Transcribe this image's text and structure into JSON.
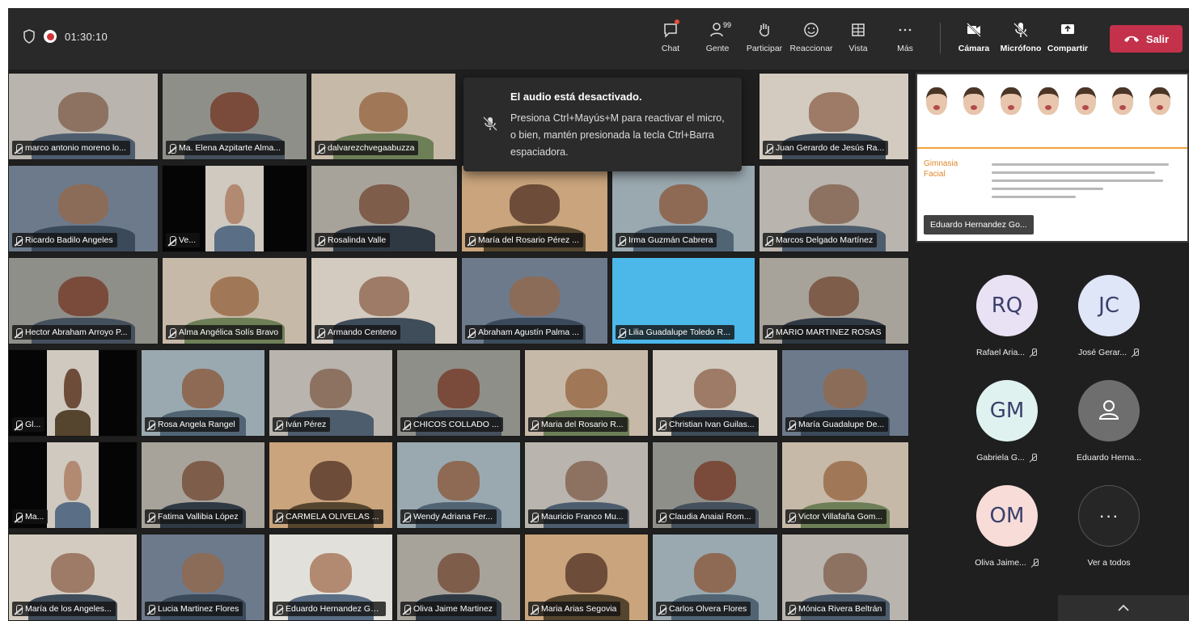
{
  "meeting": {
    "timer": "01:30:10"
  },
  "toolbar": {
    "chat": "Chat",
    "people": "Gente",
    "people_count": "99",
    "raise_hand": "Participar",
    "react": "Reaccionar",
    "view": "Vista",
    "more": "Más",
    "camera": "Cámara",
    "mic": "Micrófono",
    "share": "Compartir",
    "leave": "Salir"
  },
  "notification": {
    "title": "El audio está desactivado.",
    "body": "Presiona Ctrl+Mayús+M para reactivar el micro, o bien, mantén presionada la tecla Ctrl+Barra espaciadora."
  },
  "participants": [
    "marco antonio moreno lo...",
    "Ma. Elena Azpitarte Alma...",
    "dalvarezchvegaabuzza",
    "Juan Gerardo de Jesús Ra...",
    "Ricardo Badilo Angeles",
    "Ve...",
    "Rosalinda Valle",
    "María del Rosario Pérez ...",
    "Irma Guzmán Cabrera",
    "Marcos Delgado Martínez",
    "Hector Abraham Arroyo P...",
    "Alma Angélica Solís Bravo",
    "Armando Centeno",
    "Abraham Agustín Palma ...",
    "Lilia Guadalupe Toledo R...",
    "MARIO MARTINEZ ROSAS",
    "Gl...",
    "Rosa Angela Rangel",
    "Iván Pérez",
    "CHICOS COLLADO ...",
    "Maria del Rosario R...",
    "Christian Ivan Guilas...",
    "María Guadalupe De...",
    "Ma...",
    "Fatima Vallibia López",
    "CARMELA OLIVELAS ...",
    "Wendy Adriana Fer...",
    "Mauricio Franco Mu...",
    "Claudia Anaiaí Rom...",
    "Victor Villafaña Gom...",
    "María de los Angeles...",
    "Lucia Martinez Flores",
    "Eduardo Hernandez Go...",
    "Oliva Jaime Martinez",
    "Maria Arias Segovia",
    "Carlos Olvera Flores",
    "Mónica Rivera Beltrán"
  ],
  "shared_content": {
    "presenter": "Eduardo Hernandez Go...",
    "slide_title": "Gimnasia Facial"
  },
  "roster": [
    {
      "initials": "RQ",
      "name": "Rafael Aria...",
      "color": "#e9e2f4"
    },
    {
      "initials": "JC",
      "name": "José Gerar...",
      "color": "#dfe6f7"
    },
    {
      "initials": "GM",
      "name": "Gabriela G...",
      "color": "#dff2ef"
    },
    {
      "initials": "",
      "name": "Eduardo Herna...",
      "color": "#6e6e6e"
    },
    {
      "initials": "OM",
      "name": "Oliva Jaime...",
      "color": "#f7dcd8"
    }
  ],
  "see_all": "Ver a todos",
  "colors": {
    "leave": "#c4314b",
    "rec": "#d13438",
    "tile_blue": "#4cb8ea"
  }
}
